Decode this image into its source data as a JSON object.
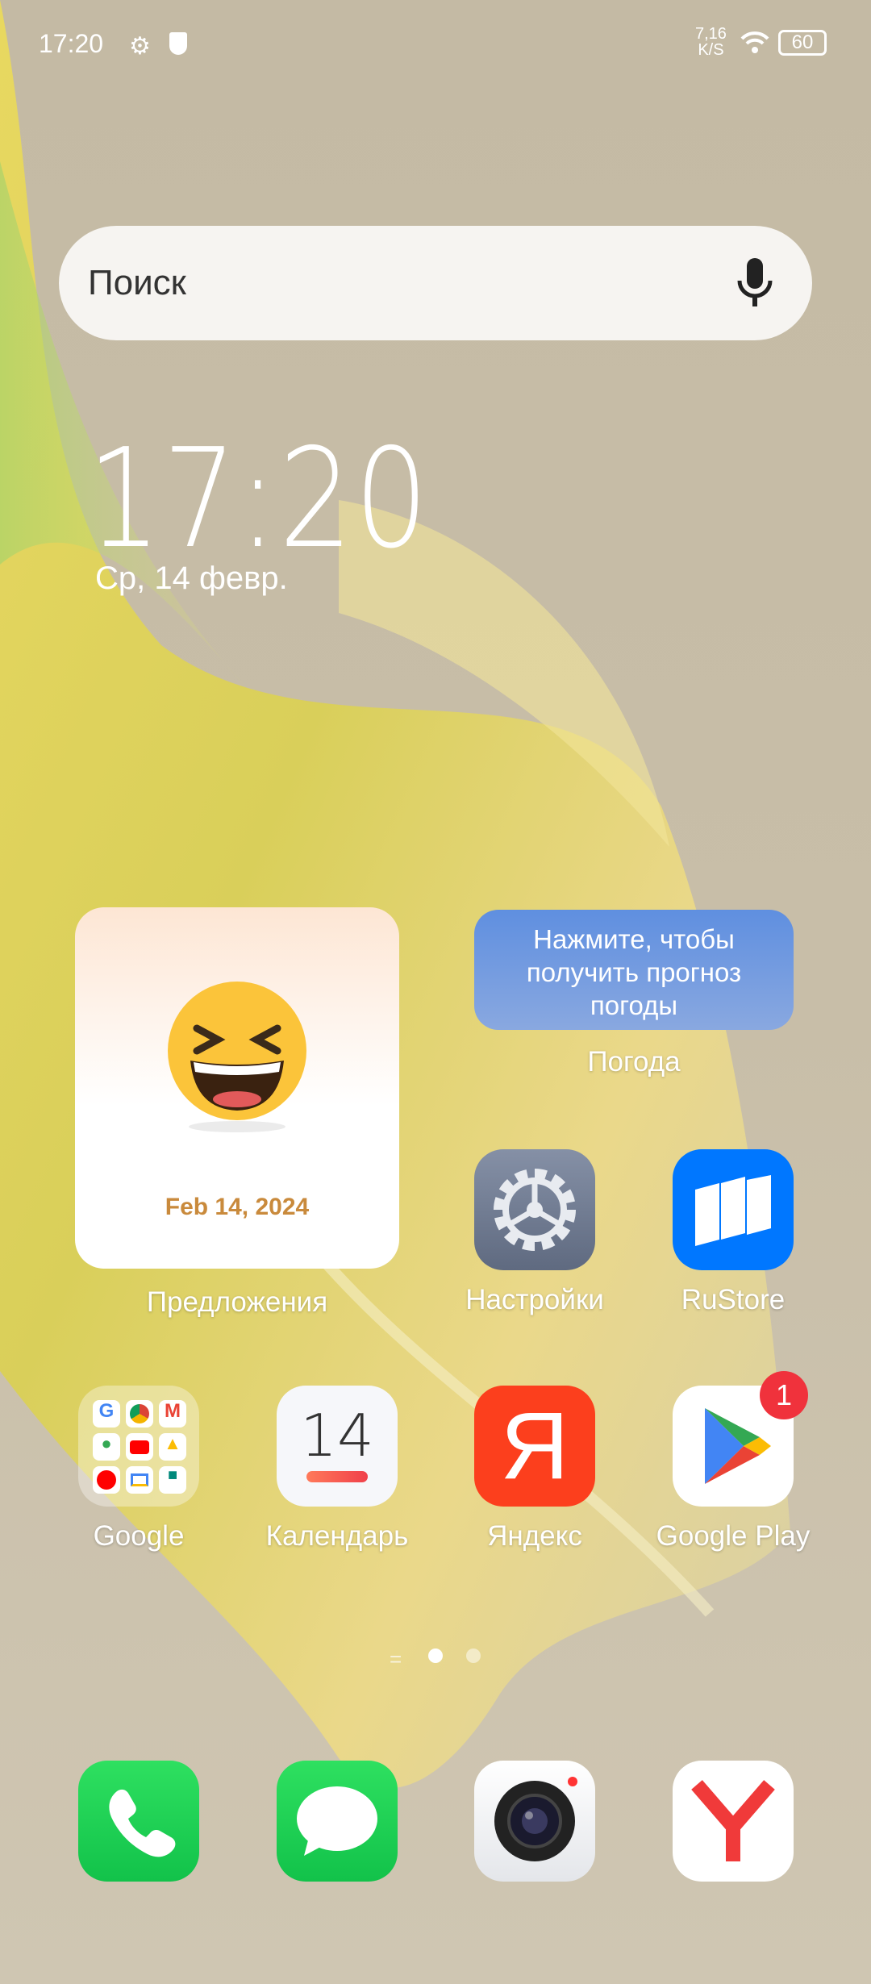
{
  "status_bar": {
    "time": "17:20",
    "net_speed_value": "7,16",
    "net_speed_unit": "K/S",
    "battery": "60",
    "icons": [
      "settings-icon",
      "shield-play-icon",
      "wifi-icon",
      "battery-icon"
    ]
  },
  "search": {
    "placeholder": "Поиск",
    "icon": "mic-icon"
  },
  "clock_widget": {
    "time": "17:20",
    "date": "Ср, 14 февр."
  },
  "suggestions_widget": {
    "date": "Feb 14, 2024",
    "label": "Предложения",
    "icon": "laughing-emoji-icon"
  },
  "weather_widget": {
    "text": "Нажмите, чтобы получить прогноз погоды",
    "label": "Погода"
  },
  "apps": [
    {
      "label": "Настройки",
      "icon": "gear-icon"
    },
    {
      "label": "RuStore",
      "icon": "rustore-icon"
    },
    {
      "label": "Google",
      "icon": "google-folder-icon"
    },
    {
      "label": "Календарь",
      "icon": "calendar-icon",
      "day": "14"
    },
    {
      "label": "Яндекс",
      "icon": "yandex-icon",
      "glyph": "Я"
    },
    {
      "label": "Google Play",
      "icon": "google-play-icon",
      "badge": "1"
    }
  ],
  "page_indicator": {
    "pages": 2,
    "current": 1
  },
  "dock": [
    {
      "icon": "phone-icon"
    },
    {
      "icon": "messages-icon"
    },
    {
      "icon": "camera-icon"
    },
    {
      "icon": "yandex-browser-icon"
    }
  ],
  "colors": {
    "accent_orange": "#c98a3c",
    "badge_red": "#f0323c",
    "yandex_red": "#fc3f1d",
    "rustore_blue": "#0077ff",
    "phone_green": "#1fcc50"
  }
}
